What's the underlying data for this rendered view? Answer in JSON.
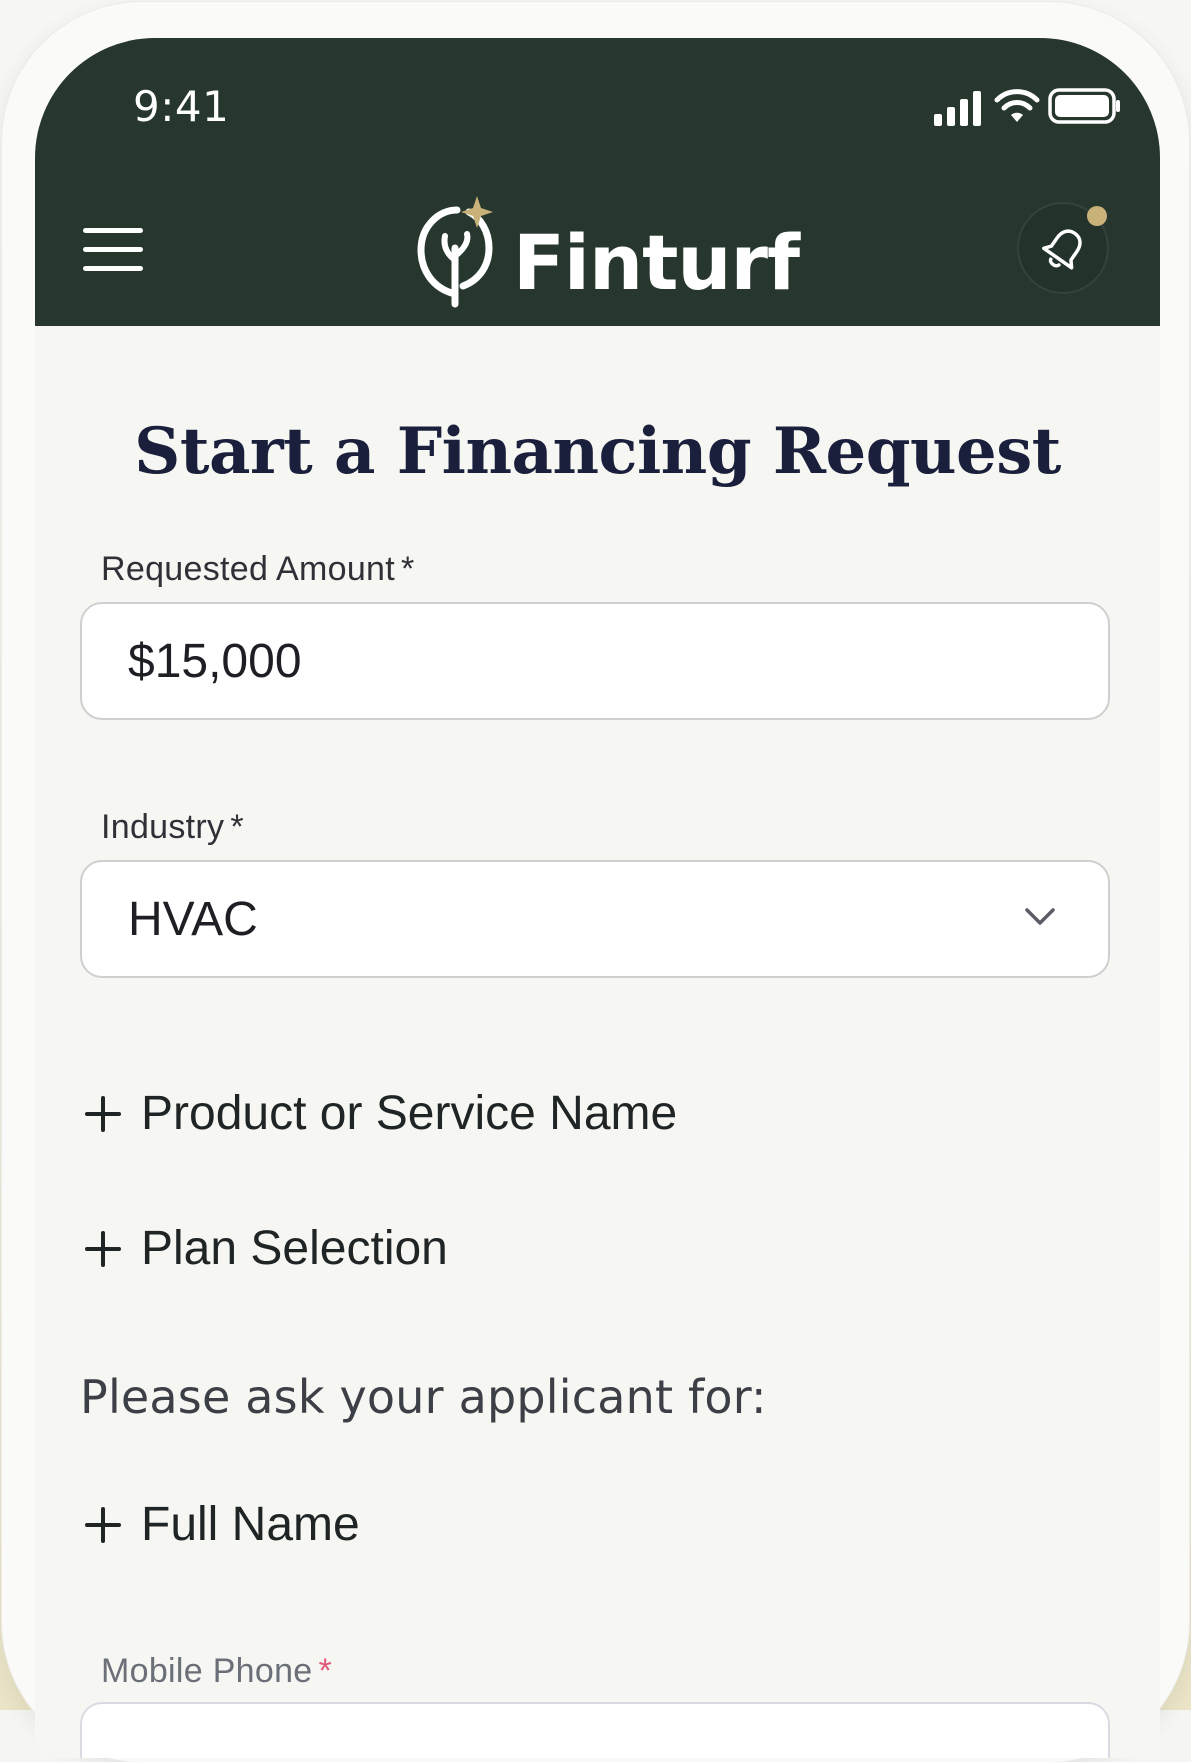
{
  "status_bar": {
    "time": "9:41",
    "icons": [
      "signal-icon",
      "wifi-icon",
      "battery-icon"
    ]
  },
  "header": {
    "menu_icon": "menu-icon",
    "logo_text": "Finturf",
    "notification_icon": "bell-icon",
    "has_unread": true
  },
  "form": {
    "title": "Start a Financing Request",
    "required_marker": "*",
    "requested_amount": {
      "label": "Requested Amount",
      "value": "$15,000"
    },
    "industry": {
      "label": "Industry",
      "value": "HVAC"
    },
    "add_product": "Product or Service Name",
    "add_plan": "Plan Selection",
    "applicant_prompt": "Please ask your applicant for:",
    "add_full_name": "Full Name",
    "mobile_phone": {
      "label": "Mobile Phone"
    }
  },
  "colors": {
    "header_bg": "#27372e",
    "accent_gold": "#c9b27a",
    "title_navy": "#1a1f3b",
    "required_pink": "#e05a7a"
  }
}
